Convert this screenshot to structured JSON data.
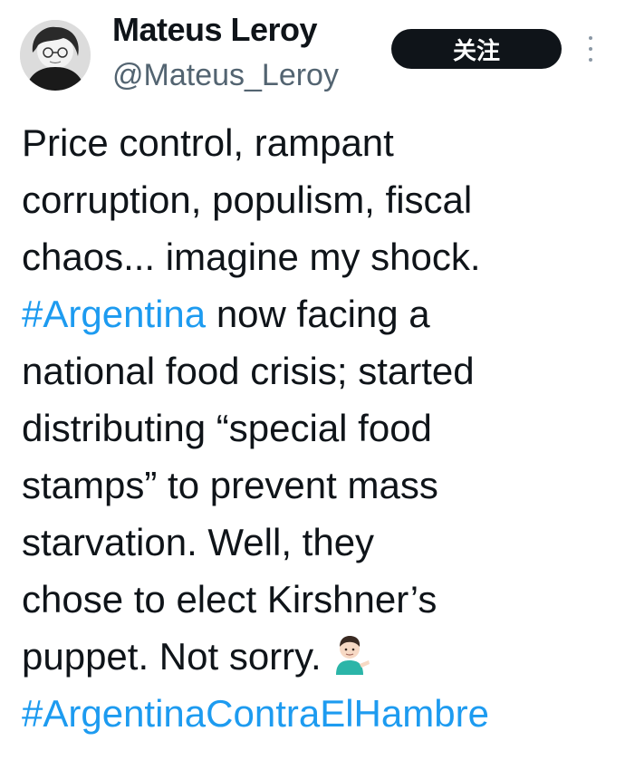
{
  "author": {
    "display_name": "Mateus Leroy",
    "handle": "@Mateus_Leroy"
  },
  "follow_button": {
    "label": "关注"
  },
  "more_menu": {
    "icon": "more-vertical-icon"
  },
  "tweet": {
    "lines": [
      {
        "text": "Price control, rampant"
      },
      {
        "text": "corruption, populism, fiscal"
      },
      {
        "text": "chaos... imagine my shock."
      },
      {
        "hashtag": "#Argentina",
        "text": " now facing a"
      },
      {
        "text": "national food crisis; started"
      },
      {
        "text": "distributing “special food"
      },
      {
        "text": "stamps” to prevent mass"
      },
      {
        "text": "starvation. Well, they"
      },
      {
        "text": "chose to elect Kirshner’s"
      },
      {
        "text": "puppet. Not sorry."
      },
      {
        "hashtag": "#ArgentinaContraElHambre"
      }
    ],
    "emoji": "person-tipping-hand-emoji"
  },
  "colors": {
    "text": "#0f1419",
    "handle": "#536471",
    "hashtag": "#1d9bf0",
    "button_bg": "#0f1419",
    "button_text": "#ffffff"
  }
}
